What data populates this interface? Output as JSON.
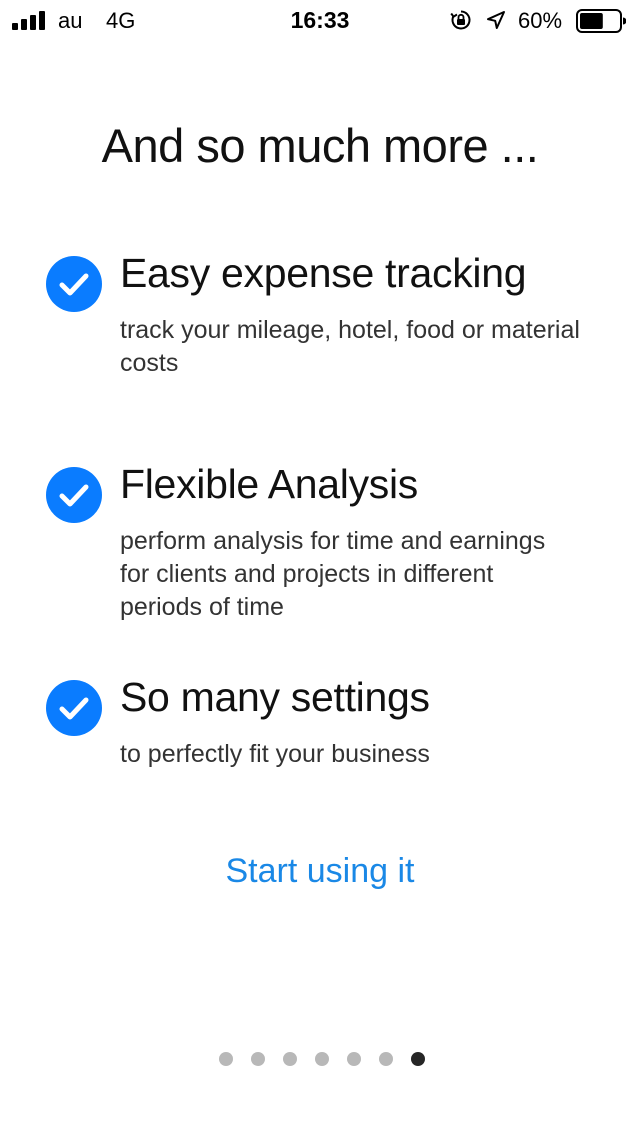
{
  "status_bar": {
    "carrier": "au",
    "network": "4G",
    "time": "16:33",
    "battery_percent": "60%",
    "battery_level": 0.6,
    "signal_bars": 4,
    "icons": [
      "signal-icon",
      "orientation-lock-icon",
      "location-arrow-icon",
      "battery-icon"
    ]
  },
  "page": {
    "title": "And so much more ..."
  },
  "features": [
    {
      "icon": "check-circle-icon",
      "title": "Easy expense tracking",
      "description": "track your mileage, hotel, food or material costs"
    },
    {
      "icon": "check-circle-icon",
      "title": "Flexible Analysis",
      "description": "perform analysis for time and earnings for clients and projects in different periods of time"
    },
    {
      "icon": "check-circle-icon",
      "title": "So many settings",
      "description": "to perfectly fit your business"
    }
  ],
  "cta": {
    "label": "Start using it"
  },
  "pager": {
    "total": 7,
    "current": 7
  },
  "colors": {
    "accent": "#1a88e6",
    "check_blue": "#0a7cff",
    "dot_inactive": "#b8b8b8",
    "dot_active": "#262626"
  }
}
